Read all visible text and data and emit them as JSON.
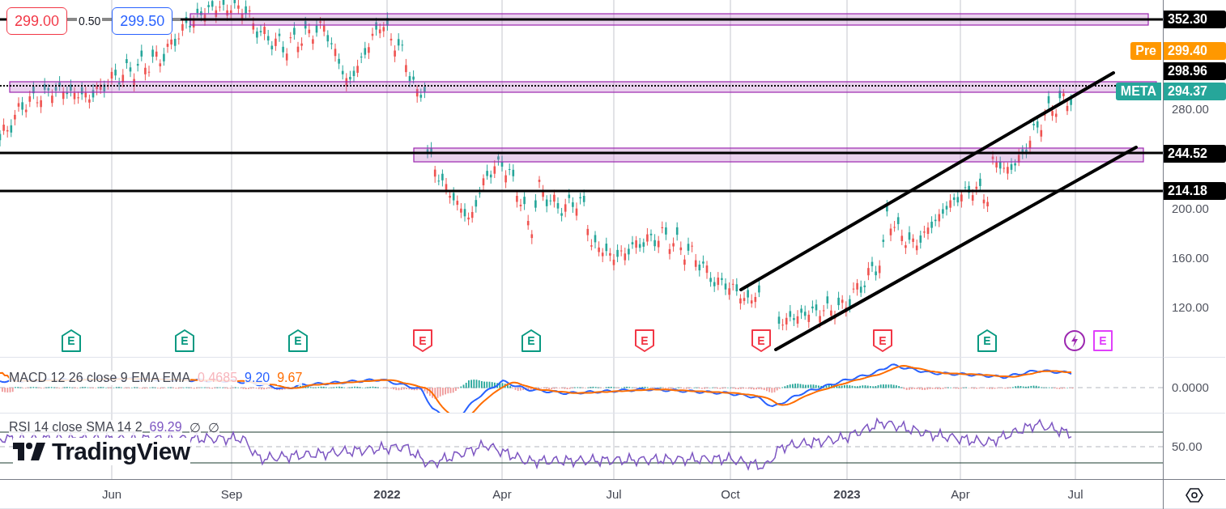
{
  "order_panel": {
    "sell_price": "299.00",
    "spread": "0.50",
    "buy_price": "299.50"
  },
  "price_labels": [
    {
      "kind": "line",
      "value": "352.30"
    },
    {
      "kind": "pre",
      "tag": "Pre",
      "value": "299.40"
    },
    {
      "kind": "line",
      "value": "298.96"
    },
    {
      "kind": "symbol",
      "tag": "META",
      "value": "294.37"
    },
    {
      "kind": "line",
      "value": "244.52"
    },
    {
      "kind": "line",
      "value": "214.18"
    }
  ],
  "price_axis_ticks": [
    "280.00",
    "200.00",
    "160.00",
    "120.00"
  ],
  "events": [
    {
      "kind": "up",
      "label": "E",
      "color": "#089981"
    },
    {
      "kind": "up",
      "label": "E",
      "color": "#089981"
    },
    {
      "kind": "up",
      "label": "E",
      "color": "#089981"
    },
    {
      "kind": "down",
      "label": "E",
      "color": "#f23645"
    },
    {
      "kind": "up",
      "label": "E",
      "color": "#089981"
    },
    {
      "kind": "down",
      "label": "E",
      "color": "#f23645"
    },
    {
      "kind": "down",
      "label": "E",
      "color": "#f23645"
    },
    {
      "kind": "down",
      "label": "E",
      "color": "#f23645"
    },
    {
      "kind": "up",
      "label": "E",
      "color": "#089981"
    },
    {
      "kind": "flash",
      "color": "#9c27b0"
    },
    {
      "kind": "square",
      "label": "E",
      "color": "#e040fb"
    }
  ],
  "macd": {
    "label": "MACD 12 26 close 9 EMA EMA",
    "histogram": "0.4685",
    "macd": "9.20",
    "signal": "9.67",
    "axis_tick": "0.0000"
  },
  "rsi": {
    "label": "RSI 14 close SMA 14 2",
    "value": "69.29",
    "extras": [
      "∅",
      "∅"
    ],
    "axis_tick": "50.00"
  },
  "logo": {
    "text": "TradingView"
  },
  "time_axis": [
    "Jun",
    "Sep",
    "2022",
    "Apr",
    "Jul",
    "Oct",
    "2023",
    "Apr",
    "Jul"
  ]
}
